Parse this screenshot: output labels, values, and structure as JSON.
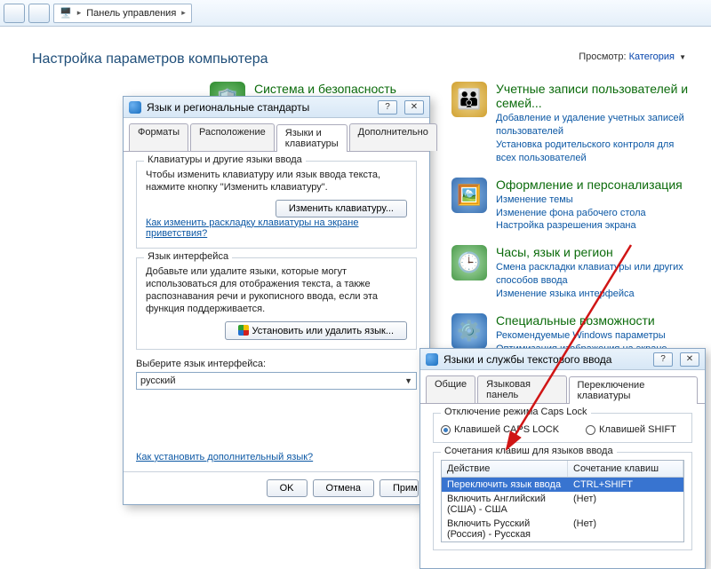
{
  "toolbar": {
    "breadcrumb": "Панель управления"
  },
  "page": {
    "title": "Настройка параметров компьютера",
    "view_label": "Просмотр:",
    "view_value": "Категория"
  },
  "left_col": {
    "security_title": "Система и безопасность"
  },
  "right_col": {
    "accounts_title": "Учетные записи пользователей и семей...",
    "accounts_l1": "Добавление и удаление учетных записей пользователей",
    "accounts_l2": "Установка родительского контроля для всех пользователей",
    "appearance_title": "Оформление и персонализация",
    "appearance_l1": "Изменение темы",
    "appearance_l2": "Изменение фона рабочего стола",
    "appearance_l3": "Настройка разрешения экрана",
    "clock_title": "Часы, язык и регион",
    "clock_l1": "Смена раскладки клавиатуры или других способов ввода",
    "clock_l2": "Изменение языка интерфейса",
    "ease_title": "Специальные возможности",
    "ease_l1": "Рекомендуемые Windows параметры",
    "ease_l2": "Оптимизация изображения на экране"
  },
  "dlg1": {
    "title": "Язык и региональные стандарты",
    "tabs": {
      "t1": "Форматы",
      "t2": "Расположение",
      "t3": "Языки и клавиатуры",
      "t4": "Дополнительно"
    },
    "grp1_title": "Клавиатуры и другие языки ввода",
    "grp1_text": "Чтобы изменить клавиатуру или язык ввода текста, нажмите кнопку \"Изменить клавиатуру\".",
    "btn_change_kb": "Изменить клавиатуру...",
    "link_layout": "Как изменить раскладку клавиатуры на экране приветствия?",
    "grp2_title": "Язык интерфейса",
    "grp2_text": "Добавьте или удалите языки, которые могут использоваться для отображения текста, а также распознавания речи и рукописного ввода, если эта функция поддерживается.",
    "btn_install": "Установить или удалить язык...",
    "select_label": "Выберите язык интерфейса:",
    "select_value": "русский",
    "link_more": "Как установить дополнительный язык?",
    "ok": "OK",
    "cancel": "Отмена",
    "apply": "Прим"
  },
  "dlg2": {
    "title": "Языки и службы текстового ввода",
    "tabs": {
      "t1": "Общие",
      "t2": "Языковая панель",
      "t3": "Переключение клавиатуры"
    },
    "caps_group": "Отключение режима Caps Lock",
    "r1": "Клавишей CAPS LOCK",
    "r2": "Клавишей SHIFT",
    "combo_group": "Сочетания клавиш для языков ввода",
    "col_a": "Действие",
    "col_b": "Сочетание клавиш",
    "rows": [
      {
        "a": "Переключить язык ввода",
        "b": "CTRL+SHIFT"
      },
      {
        "a": "Включить Английский (США) - США",
        "b": "(Нет)"
      },
      {
        "a": "Включить Русский (Россия) - Русская",
        "b": "(Нет)"
      }
    ]
  }
}
